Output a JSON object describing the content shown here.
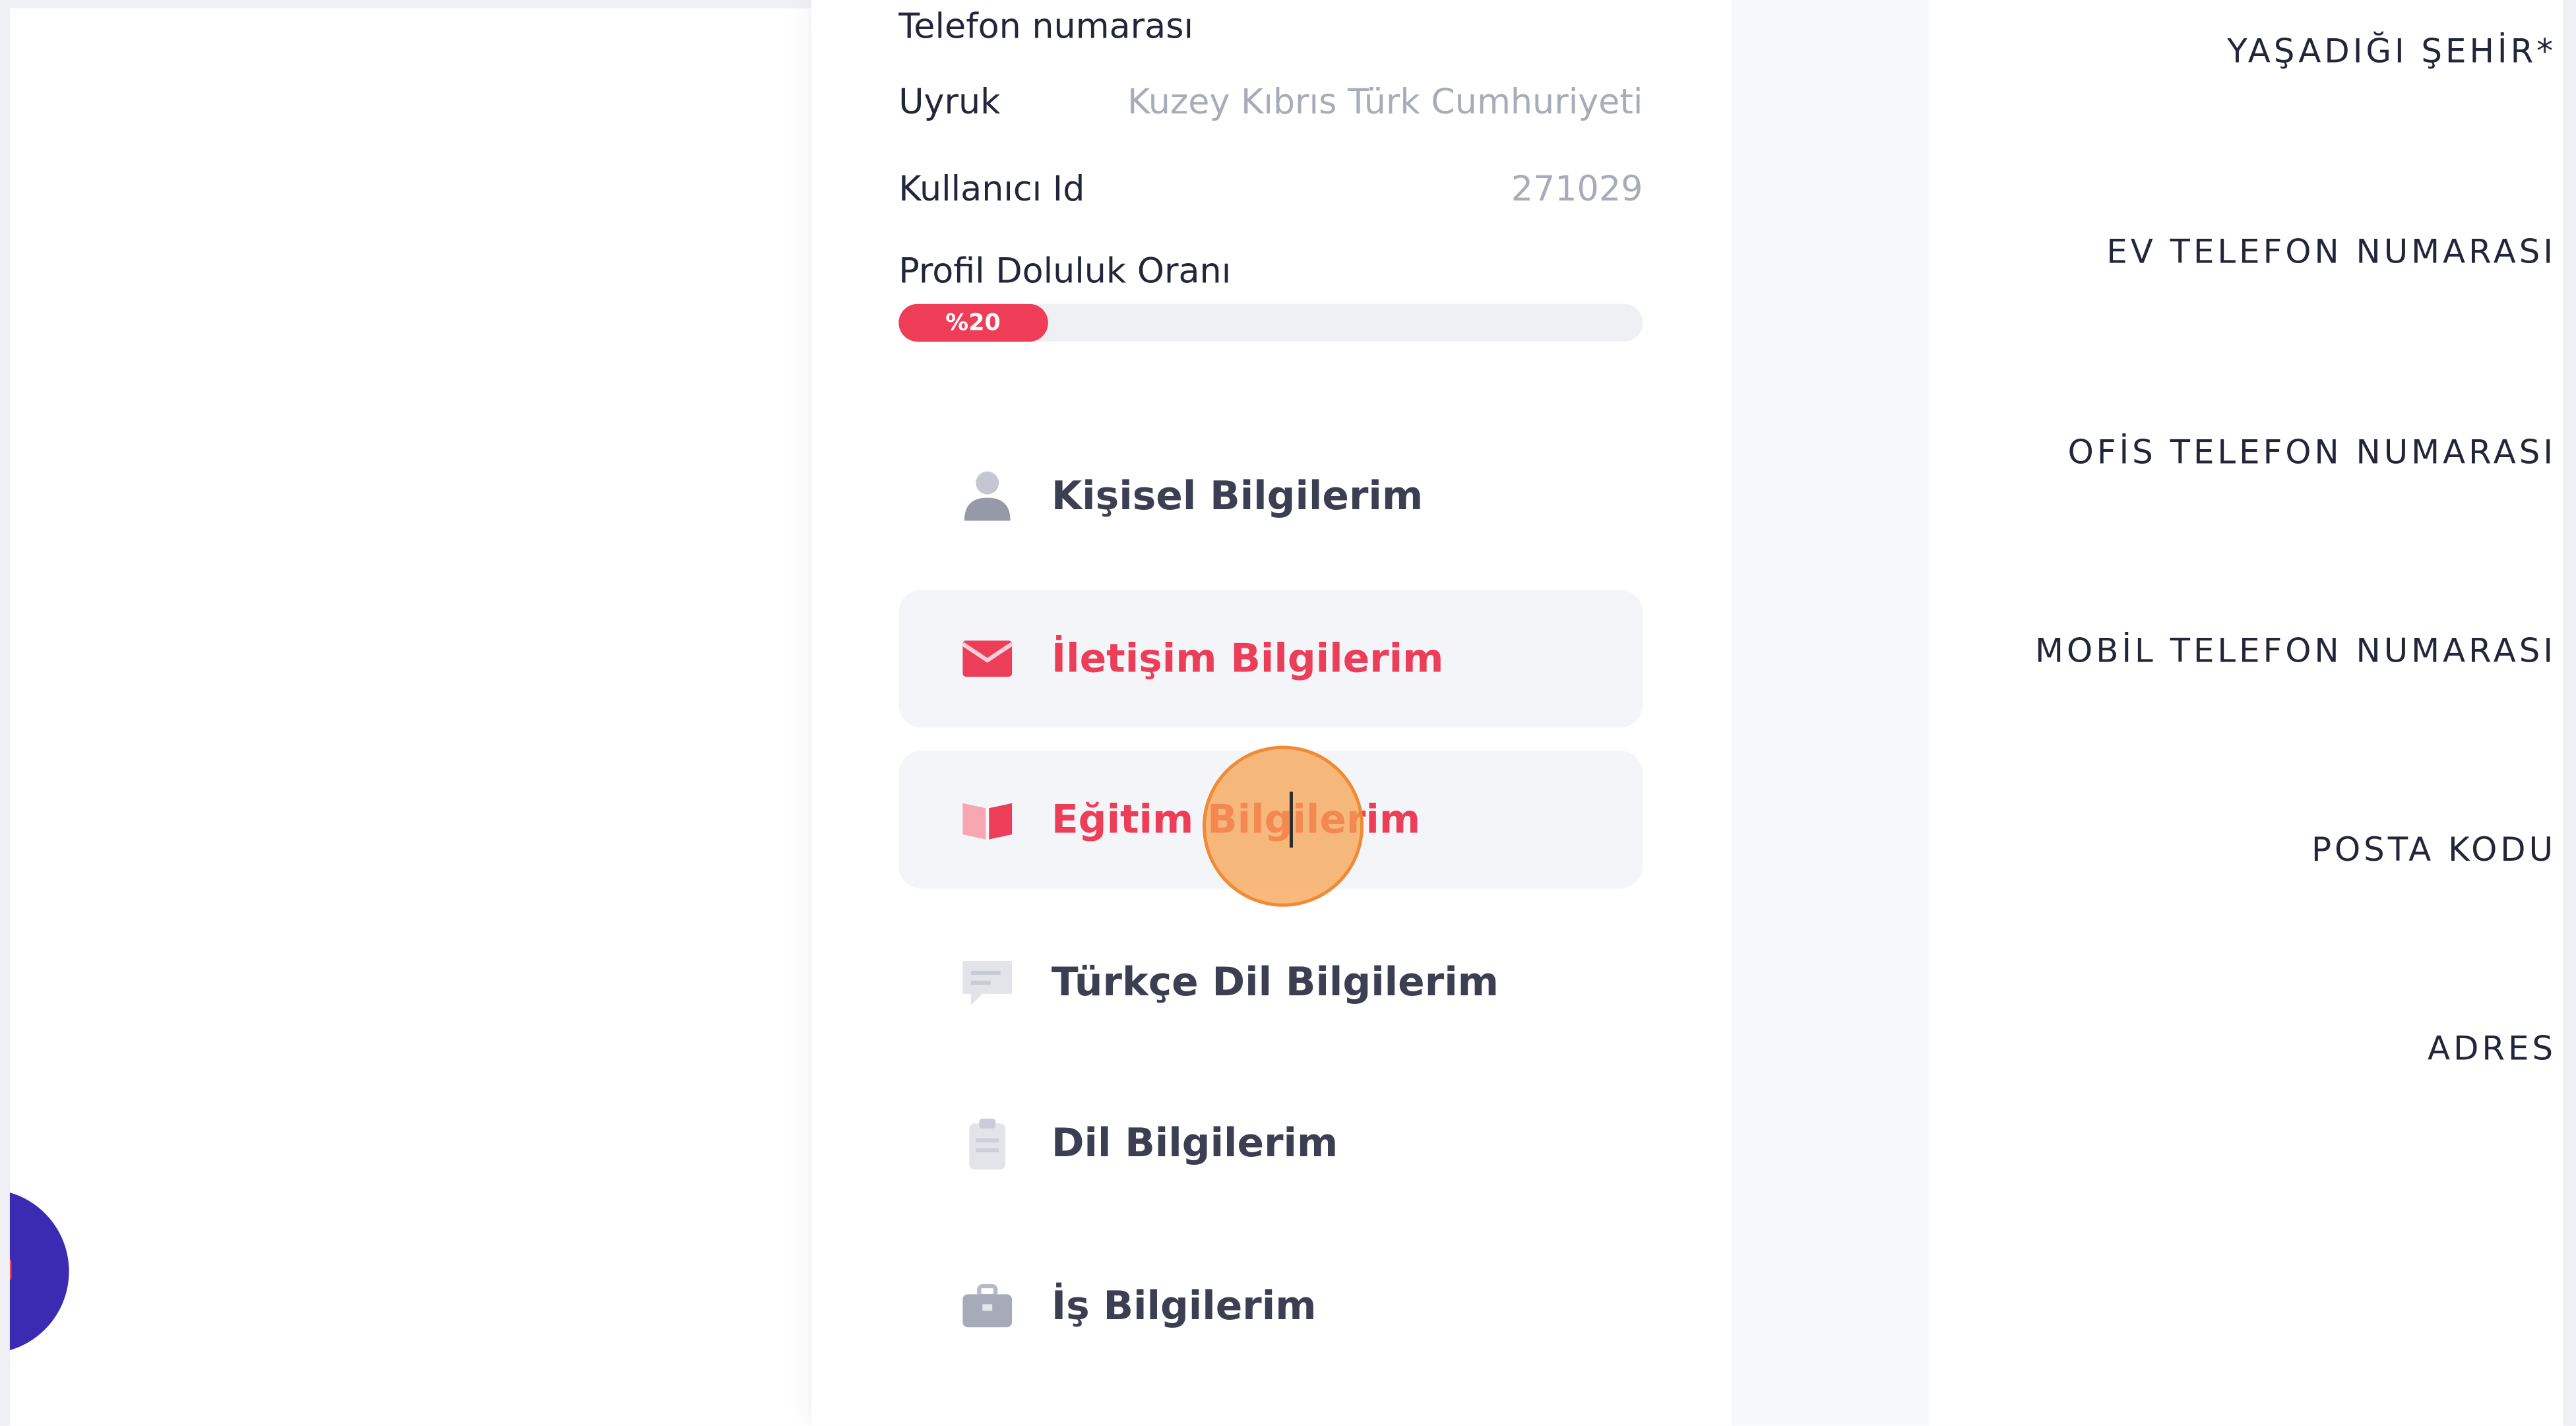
{
  "profile": {
    "phone_label": "Telefon numarası",
    "nationality_label": "Uyruk",
    "nationality_value": "Kuzey Kıbrıs Türk Cumhuriyeti",
    "user_id_label": "Kullanıcı Id",
    "user_id_value": "271029",
    "completion_label": "Profil Doluluk Oranı",
    "completion_text": "%20",
    "completion_percent": 20
  },
  "menu": {
    "items": [
      {
        "label": "Kişisel Bilgilerim",
        "icon": "user-icon"
      },
      {
        "label": "İletişim Bilgilerim",
        "icon": "envelope-icon"
      },
      {
        "label": "Eğitim Bilgilerim",
        "icon": "book-icon"
      },
      {
        "label": "Türkçe Dil Bilgilerim",
        "icon": "chat-icon"
      },
      {
        "label": "Dil Bilgilerim",
        "icon": "clipboard-icon"
      },
      {
        "label": "İş Bilgilerim",
        "icon": "briefcase-icon"
      }
    ],
    "active_index": 1,
    "hovered_index": 2
  },
  "contact_form": {
    "fields": [
      "YAŞADIĞI ŞEHİR*",
      "EV TELEFON NUMARASI",
      "OFİS TELEFON NUMARASI",
      "MOBİL TELEFON NUMARASI",
      "POSTA KODU",
      "ADRES"
    ]
  },
  "colors": {
    "accent": "#ec3e58",
    "progress_track": "#eef0f3",
    "fab": "#3b2bb3",
    "cursor_highlight": "#f7a150"
  }
}
